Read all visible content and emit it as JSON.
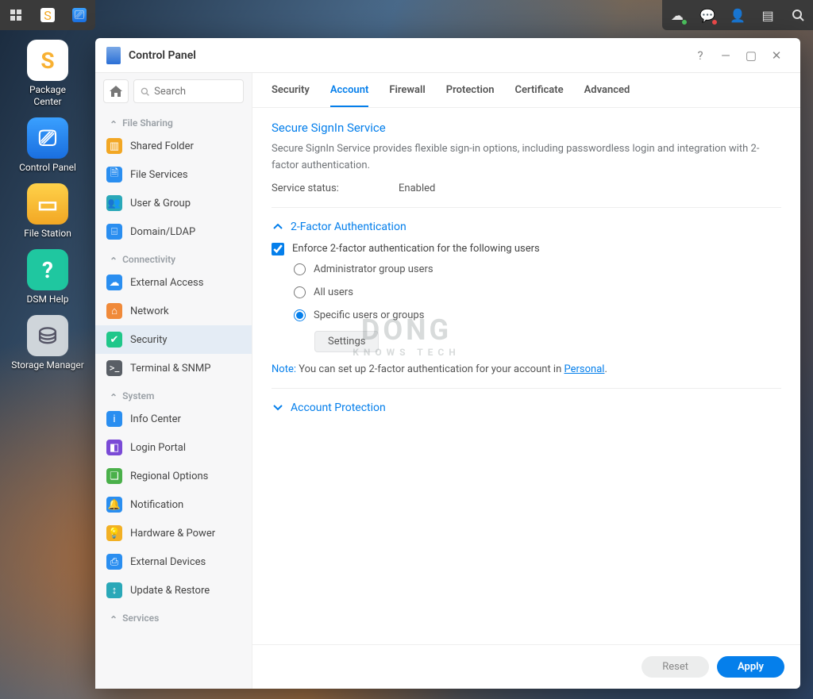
{
  "desktop_apps": [
    {
      "label": "Package\nCenter",
      "bg": "#ffffff",
      "fg": "#f8b133",
      "glyph": "S"
    },
    {
      "label": "Control Panel",
      "bg": "linear-gradient(#3aa0ff,#1a6fe0)",
      "fg": "#fff",
      "glyph": "⎚"
    },
    {
      "label": "File Station",
      "bg": "linear-gradient(#ffd24a,#f2a724)",
      "fg": "#fff",
      "glyph": "▭"
    },
    {
      "label": "DSM Help",
      "bg": "#1fc7a0",
      "fg": "#fff",
      "glyph": "?"
    },
    {
      "label": "Storage Manager",
      "bg": "#cfd5da",
      "fg": "#556",
      "glyph": "⛁"
    }
  ],
  "window": {
    "title": "Control Panel",
    "search_placeholder": "Search",
    "groups": [
      {
        "name": "File Sharing",
        "items": [
          {
            "label": "Shared Folder",
            "ic_bg": "#f2a724",
            "glyph": "▥"
          },
          {
            "label": "File Services",
            "ic_bg": "#2a8ef0",
            "glyph": "🗎"
          },
          {
            "label": "User & Group",
            "ic_bg": "#2aa8b8",
            "glyph": "👥"
          },
          {
            "label": "Domain/LDAP",
            "ic_bg": "#2a8ef0",
            "glyph": "⌸"
          }
        ]
      },
      {
        "name": "Connectivity",
        "items": [
          {
            "label": "External Access",
            "ic_bg": "#2a8ef0",
            "glyph": "☁"
          },
          {
            "label": "Network",
            "ic_bg": "#f08a3a",
            "glyph": "⌂"
          },
          {
            "label": "Security",
            "ic_bg": "#1fc78a",
            "glyph": "✔",
            "active": true
          },
          {
            "label": "Terminal & SNMP",
            "ic_bg": "#5a5f66",
            "glyph": ">_"
          }
        ]
      },
      {
        "name": "System",
        "items": [
          {
            "label": "Info Center",
            "ic_bg": "#2a8ef0",
            "glyph": "i"
          },
          {
            "label": "Login Portal",
            "ic_bg": "#7a4ad6",
            "glyph": "◧"
          },
          {
            "label": "Regional Options",
            "ic_bg": "#4ab04a",
            "glyph": "❏"
          },
          {
            "label": "Notification",
            "ic_bg": "#2a8ef0",
            "glyph": "🔔"
          },
          {
            "label": "Hardware & Power",
            "ic_bg": "#f2b024",
            "glyph": "💡"
          },
          {
            "label": "External Devices",
            "ic_bg": "#2a8ef0",
            "glyph": "⎙"
          },
          {
            "label": "Update & Restore",
            "ic_bg": "#2aa8b8",
            "glyph": "↕"
          }
        ]
      },
      {
        "name": "Services",
        "items": []
      }
    ],
    "tabs": [
      "Security",
      "Account",
      "Firewall",
      "Protection",
      "Certificate",
      "Advanced"
    ],
    "active_tab": 1,
    "content": {
      "section_title": "Secure SignIn Service",
      "section_desc": "Secure SignIn Service provides flexible sign-in options, including passwordless login and integration with 2-factor authentication.",
      "status_label": "Service status:",
      "status_value": "Enabled",
      "twofa_title": "2-Factor Authentication",
      "enforce_label": "Enforce 2-factor authentication for the following users",
      "radio_admin": "Administrator group users",
      "radio_all": "All users",
      "radio_specific": "Specific users or groups",
      "settings_btn": "Settings",
      "note_label": "Note:",
      "note_text": " You can set up 2-factor authentication for your account in ",
      "note_link": "Personal",
      "acct_prot_title": "Account Protection"
    },
    "buttons": {
      "reset": "Reset",
      "apply": "Apply"
    }
  },
  "watermark": {
    "big": "DONG",
    "small": "KNOWS TECH"
  }
}
